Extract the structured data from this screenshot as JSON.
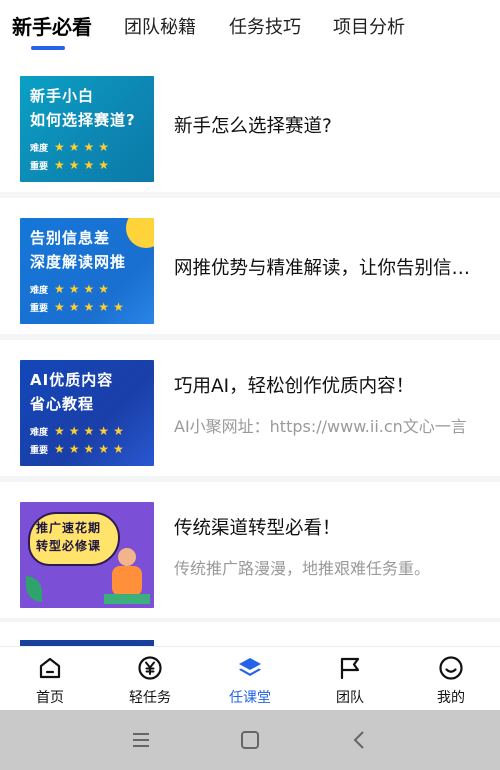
{
  "tabs": [
    "新手必看",
    "团队秘籍",
    "任务技巧",
    "项目分析"
  ],
  "active_tab": 0,
  "accent_color": "#2563eb",
  "articles": [
    {
      "title": "新手怎么选择赛道?",
      "subtitle": "",
      "thumb": {
        "line1": "新手小白",
        "line2": "如何选择赛道?",
        "row1_label": "难度",
        "row2_label": "重要",
        "row1_stars": 4,
        "row2_stars": 4
      }
    },
    {
      "title": "网推优势与精准解读，让你告别信息差",
      "subtitle": "",
      "thumb": {
        "line1": "告别信息差",
        "line2": "深度解读网推",
        "row1_label": "难度",
        "row2_label": "重要",
        "row1_stars": 4,
        "row2_stars": 5
      }
    },
    {
      "title": "巧用AI，轻松创作优质内容！",
      "subtitle": "AI小聚网址：https://www.ii.cn文心一言",
      "thumb": {
        "line1": "AI优质内容",
        "line2": "省心教程",
        "row1_label": "难度",
        "row2_label": "重要",
        "row1_stars": 5,
        "row2_stars": 5
      }
    },
    {
      "title": "传统渠道转型必看！",
      "subtitle": "传统推广路漫漫，地推艰难任务重。",
      "thumb": {
        "line1": "推广速花期",
        "line2": "转型必修课"
      }
    }
  ],
  "bottom_nav": [
    {
      "label": "首页",
      "icon": "home-icon"
    },
    {
      "label": "轻任务",
      "icon": "yen-coin-icon"
    },
    {
      "label": "任课堂",
      "icon": "layers-icon"
    },
    {
      "label": "团队",
      "icon": "flag-icon"
    },
    {
      "label": "我的",
      "icon": "smile-face-icon"
    }
  ],
  "active_nav": 2,
  "system_nav": [
    "menu-icon",
    "home-square-icon",
    "back-chevron-icon"
  ]
}
